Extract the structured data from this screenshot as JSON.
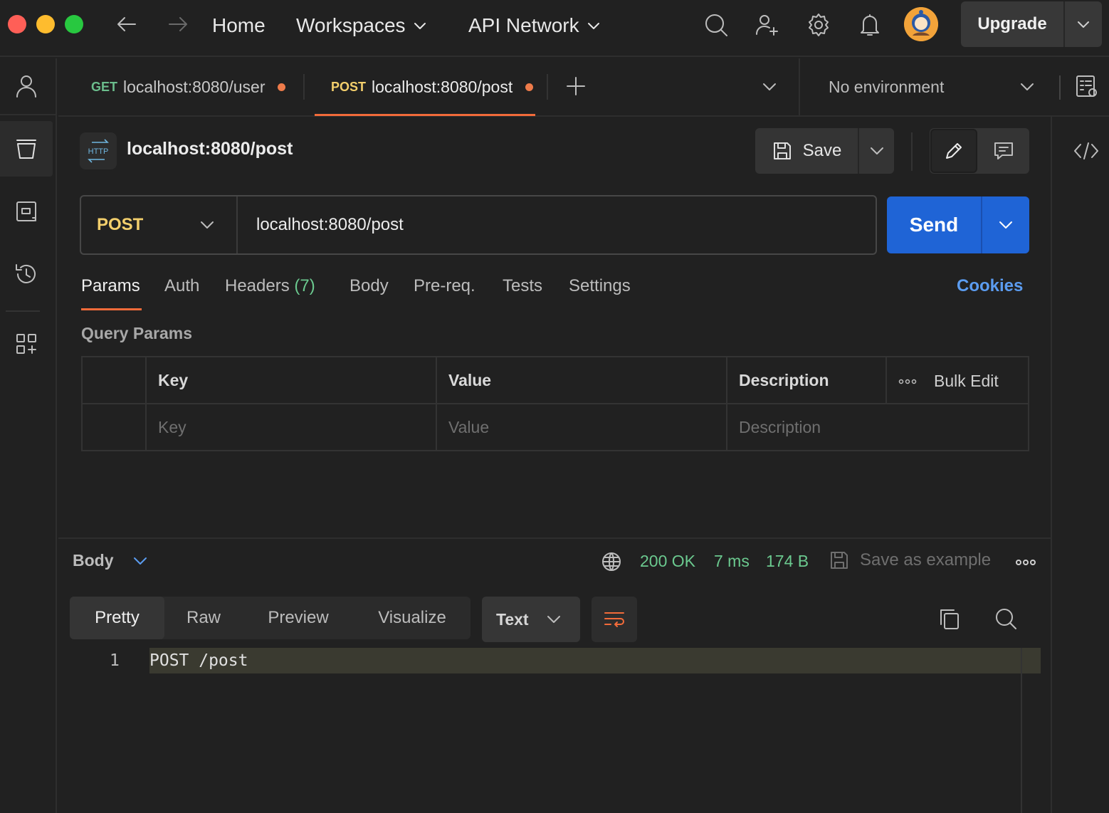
{
  "topbar": {
    "nav": {
      "home": "Home",
      "workspaces": "Workspaces",
      "api_network": "API Network"
    },
    "upgrade_label": "Upgrade"
  },
  "tabs": [
    {
      "method": "GET",
      "url": "localhost:8080/user",
      "unsaved": true,
      "active": false
    },
    {
      "method": "POST",
      "url": "localhost:8080/post",
      "unsaved": true,
      "active": true
    }
  ],
  "environment": {
    "selected": "No environment"
  },
  "request": {
    "title": "localhost:8080/post",
    "http_badge": "HTTP",
    "save_label": "Save",
    "method": "POST",
    "url": "localhost:8080/post",
    "send_label": "Send"
  },
  "request_tabs": {
    "params": "Params",
    "auth": "Auth",
    "headers": "Headers",
    "headers_count": "(7)",
    "body": "Body",
    "prereq": "Pre-req.",
    "tests": "Tests",
    "settings": "Settings",
    "cookies": "Cookies",
    "active": "Params"
  },
  "query_params": {
    "heading": "Query Params",
    "columns": {
      "key": "Key",
      "value": "Value",
      "description": "Description"
    },
    "bulk_edit": "Bulk Edit",
    "placeholders": {
      "key": "Key",
      "value": "Value",
      "description": "Description"
    }
  },
  "response": {
    "section_label": "Body",
    "status": "200 OK",
    "time": "7 ms",
    "size": "174 B",
    "save_example": "Save as example",
    "views": {
      "pretty": "Pretty",
      "raw": "Raw",
      "preview": "Preview",
      "visualize": "Visualize",
      "active": "Pretty"
    },
    "format": "Text",
    "lines": [
      {
        "num": "1",
        "text": "POST /post"
      }
    ]
  },
  "colors": {
    "accent_orange": "#f26b3a",
    "send_blue": "#1f64d6",
    "post_yellow": "#f3cf6c",
    "get_green": "#6bbd8c",
    "status_green": "#6bc98f",
    "cookies_blue": "#5b9cf0"
  }
}
